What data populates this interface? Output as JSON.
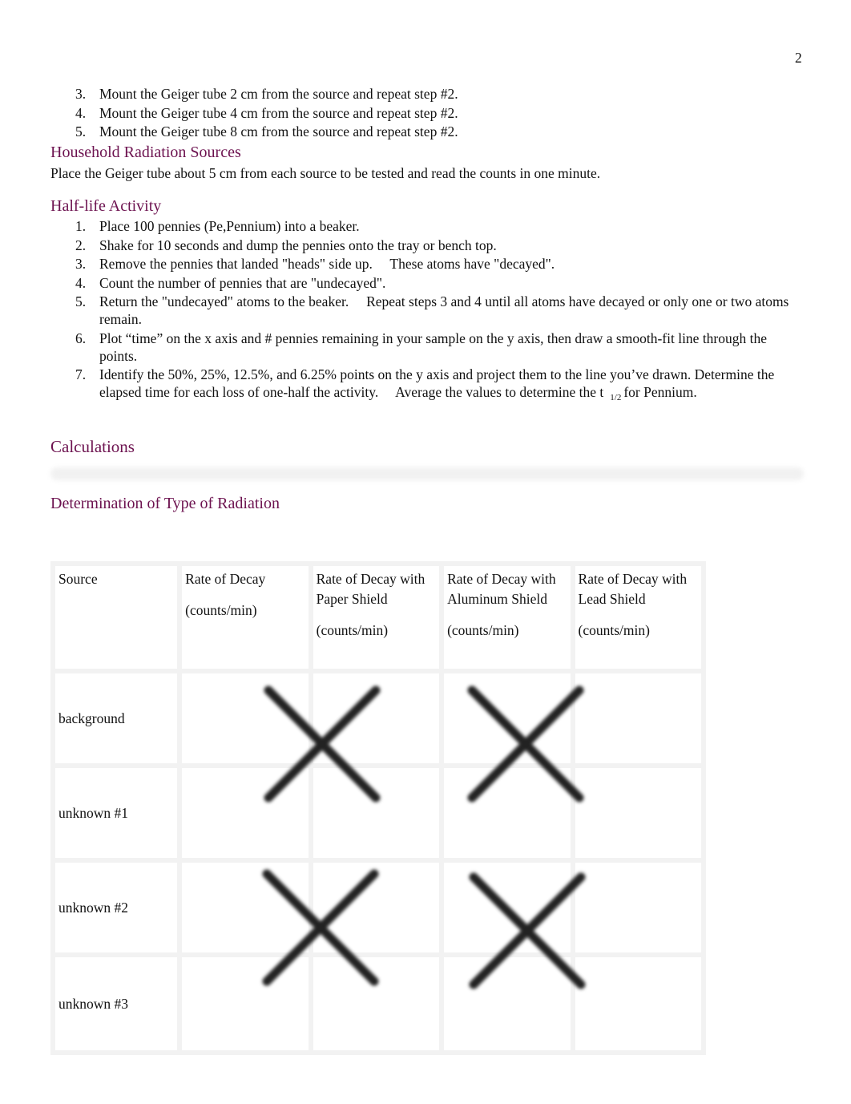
{
  "page": {
    "number": "2"
  },
  "distance_steps": [
    {
      "num": "3.",
      "text": "Mount the Geiger tube 2 cm from the source and repeat step #2."
    },
    {
      "num": "4.",
      "text": "Mount the Geiger tube 4 cm from the source and repeat step #2."
    },
    {
      "num": "5.",
      "text": "Mount the Geiger tube 8 cm from the source and repeat step #2."
    }
  ],
  "household": {
    "heading": "Household Radiation Sources",
    "text": "Place the Geiger tube about 5 cm from each source to be tested and read the counts in one minute."
  },
  "halflife": {
    "heading": "Half-life Activity",
    "steps": [
      {
        "num": "1.",
        "text": "Place 100 pennies (Pe,Pennium) into a beaker."
      },
      {
        "num": "2.",
        "text": "Shake for 10 seconds and dump the pennies onto the tray or bench top."
      },
      {
        "num": "3.",
        "text": "Remove the pennies that landed \"heads\" side up.     These atoms have \"decayed\"."
      },
      {
        "num": "4.",
        "text": "Count the number of pennies that are \"undecayed\"."
      },
      {
        "num": "5.",
        "text": "Return the \"undecayed\" atoms to the beaker.     Repeat steps 3 and 4 until all atoms have decayed or only one or two atoms remain."
      },
      {
        "num": "6.",
        "text": "Plot “time” on the x axis and # pennies remaining in your sample on the y axis, then draw a smooth-fit line through the points."
      },
      {
        "num": "7.",
        "text_before": "Identify the 50%, 25%, 12.5%, and 6.25% points on the y axis and project them to the line you’ve drawn. Determine the elapsed time for each loss of one-half the activity.     Average the values to determine the t",
        "subscript": "1/2",
        "text_after": "for Pennium."
      }
    ]
  },
  "calculations": {
    "heading": "Calculations",
    "subheading": "Determination of Type of Radiation"
  },
  "radiation_table": {
    "headers": [
      {
        "title": "Source",
        "unit": ""
      },
      {
        "title": "Rate of Decay",
        "unit": "(counts/min)"
      },
      {
        "title": "Rate of Decay with Paper Shield",
        "unit": "(counts/min)"
      },
      {
        "title": "Rate of Decay with Aluminum Shield",
        "unit": "(counts/min)"
      },
      {
        "title": "Rate of Decay with Lead Shield",
        "unit": "(counts/min)"
      }
    ],
    "rows": [
      {
        "source": "background",
        "values": [
          "",
          "",
          "",
          ""
        ]
      },
      {
        "source": "unknown #1",
        "values": [
          "",
          "",
          "",
          ""
        ]
      },
      {
        "source": "unknown #2",
        "values": [
          "",
          "",
          "",
          ""
        ]
      },
      {
        "source": "unknown #3",
        "values": [
          "",
          "",
          "",
          ""
        ]
      }
    ],
    "crossed_out_marks": [
      {
        "rows": "background / unknown #1",
        "columns": "Rate of Decay / with Paper Shield"
      },
      {
        "rows": "background / unknown #1",
        "columns": "with Aluminum Shield / with Lead Shield"
      },
      {
        "rows": "unknown #2 / unknown #3",
        "columns": "Rate of Decay / with Paper Shield"
      },
      {
        "rows": "unknown #2 / unknown #3",
        "columns": "with Aluminum Shield / with Lead Shield"
      }
    ],
    "mark_color": "#222222"
  },
  "colors": {
    "heading": "#6d1350",
    "text": "#111111",
    "grid": "#f2f2f2"
  }
}
